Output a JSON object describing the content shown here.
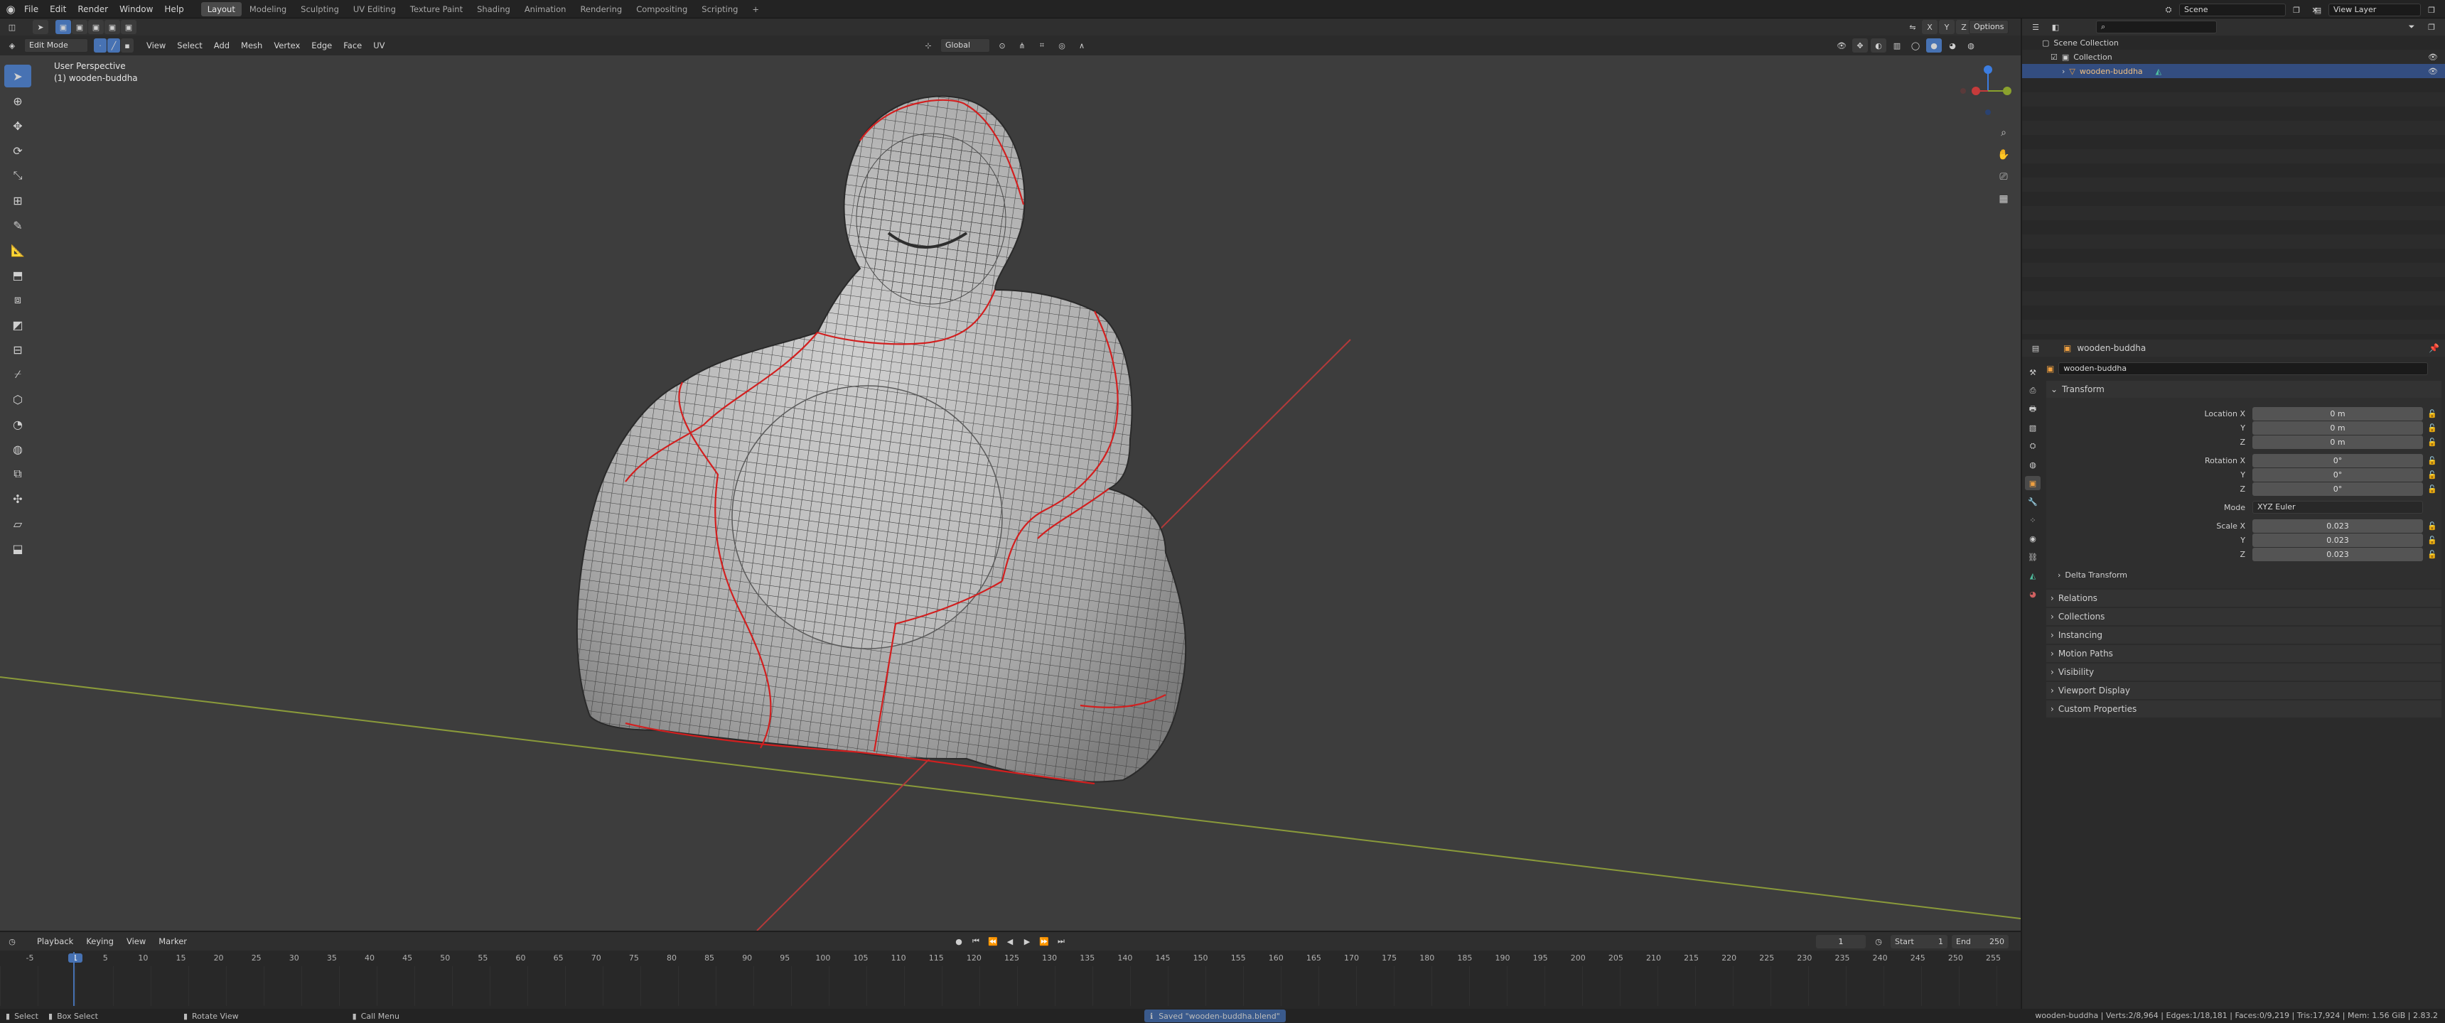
{
  "topbar": {
    "menus": [
      "File",
      "Edit",
      "Render",
      "Window",
      "Help"
    ],
    "workspaces": [
      {
        "label": "Layout",
        "active": true
      },
      {
        "label": "Modeling"
      },
      {
        "label": "Sculpting"
      },
      {
        "label": "UV Editing"
      },
      {
        "label": "Texture Paint"
      },
      {
        "label": "Shading"
      },
      {
        "label": "Animation"
      },
      {
        "label": "Rendering"
      },
      {
        "label": "Compositing"
      },
      {
        "label": "Scripting"
      }
    ],
    "add_tab": "+",
    "scene": "Scene",
    "view_layer": "View Layer"
  },
  "viewport_header": {
    "mode": "Edit Mode",
    "menus": [
      "View",
      "Select",
      "Add",
      "Mesh",
      "Vertex",
      "Edge",
      "Face",
      "UV"
    ],
    "orientation": "Global",
    "options": "Options",
    "axis_x": "X",
    "axis_y": "Y",
    "axis_z": "Z"
  },
  "viewport": {
    "view_name": "User Perspective",
    "object_label": "(1) wooden-buddha"
  },
  "outliner": {
    "scene_collection": "Scene Collection",
    "collection": "Collection",
    "object": "wooden-buddha"
  },
  "properties": {
    "object_name_header": "wooden-buddha",
    "object_name_field": "wooden-buddha",
    "transform_label": "Transform",
    "location_label": "Location X",
    "y_label": "Y",
    "z_label": "Z",
    "location": [
      "0 m",
      "0 m",
      "0 m"
    ],
    "rotation_label": "Rotation X",
    "rotation": [
      "0°",
      "0°",
      "0°"
    ],
    "mode_label": "Mode",
    "mode_value": "XYZ Euler",
    "scale_label": "Scale X",
    "scale": [
      "0.023",
      "0.023",
      "0.023"
    ],
    "delta_transform": "Delta Transform",
    "panels": [
      "Relations",
      "Collections",
      "Instancing",
      "Motion Paths",
      "Visibility",
      "Viewport Display",
      "Custom Properties"
    ]
  },
  "timeline": {
    "menus": [
      "Playback",
      "Keying",
      "View",
      "Marker"
    ],
    "current_frame": "1",
    "start_label": "Start",
    "start": "1",
    "end_label": "End",
    "end": "250",
    "ruler": [
      "-5",
      "1",
      "5",
      "10",
      "15",
      "20",
      "25",
      "30",
      "35",
      "40",
      "45",
      "50",
      "55",
      "60",
      "65",
      "70",
      "75",
      "80",
      "85",
      "90",
      "95",
      "100",
      "105",
      "110",
      "115",
      "120",
      "125",
      "130",
      "135",
      "140",
      "145",
      "150",
      "155",
      "160",
      "165",
      "170",
      "175",
      "180",
      "185",
      "190",
      "195",
      "200",
      "205",
      "210",
      "215",
      "220",
      "225",
      "230",
      "235",
      "240",
      "245",
      "250",
      "255"
    ]
  },
  "statusbar": {
    "select": "Select",
    "box_select": "Box Select",
    "rotate_view": "Rotate View",
    "call_menu": "Call Menu",
    "saved_message": "Saved \"wooden-buddha.blend\"",
    "stats": "wooden-buddha | Verts:2/8,964 | Edges:1/18,181 | Faces:0/9,219 | Tris:17,924 | Mem: 1.56 GiB | 2.83.2"
  },
  "colors": {
    "accent": "#4772b3",
    "seam": "#d21f1f",
    "x_axis": "#c63b3b",
    "y_axis": "#8aa12d",
    "z_axis": "#3c7de0"
  }
}
